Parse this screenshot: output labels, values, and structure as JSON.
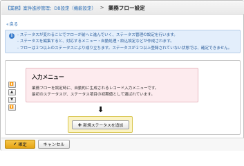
{
  "breadcrumb": {
    "crumb": "【業務】案件進捗管理：DB設定（機能設定）",
    "separator": ">",
    "title": "業務フロー設定"
  },
  "back_link": {
    "arrow": "«",
    "label": "戻る"
  },
  "info": {
    "icon": "info-icon",
    "lines": [
      "- ステータスが変わることでフローが前へと進んでいく、ステータス管理の設定を行います。",
      "- ステータスを編集すると、対応するメニュー・自動処理・絞込設定などが作成されます。",
      "- フローは２つ以上のステータスにより成り立ちます。ステータスが２つ以上登録されていない状態では、確定できません。"
    ]
  },
  "side_controls": [
    "⏫",
    "▲",
    "▼",
    "⏬"
  ],
  "input_menu": {
    "title": "入力メニュー",
    "lines": [
      "業務フローを設定時に、自動的に生成されるレコード入力メニューです。",
      "最初のステータスが、ステータス項目の初期値として選ばれています。"
    ]
  },
  "flow_arrow": "🡇",
  "add_status": {
    "icon": "plus-icon",
    "plus": "✚",
    "label": "新規ステータスを追加"
  },
  "footer": {
    "confirm_icon": "check-icon",
    "confirm_check": "✔",
    "confirm_label": "確定",
    "cancel_label": "キャンセル"
  },
  "colors": {
    "link": "#2a6db5",
    "info_bg": "#e3eefb",
    "menu_card_bg": "#fdebee",
    "highlight_bg": "#fbf3c5",
    "confirm_bg": "#f0b730"
  }
}
